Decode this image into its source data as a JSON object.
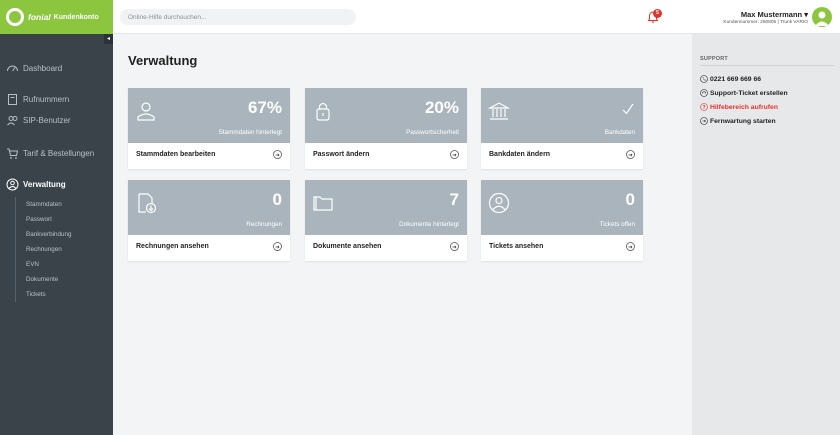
{
  "header": {
    "brand_name": "fonial",
    "brand_sub": "Kundenkonto",
    "search_placeholder": "Online-Hilfe durchsuchen...",
    "notification_count": "5",
    "user_name": "Max Mustermann ▾",
    "user_meta": "Kundennummer: 280805 | Trunk VARIO"
  },
  "sidebar": {
    "collapse_glyph": "◂",
    "items": [
      {
        "label": "Dashboard",
        "icon": "dashboard-icon"
      },
      {
        "label": "Rufnummern",
        "icon": "phonebook-icon"
      },
      {
        "label": "SIP-Benutzer",
        "icon": "users-icon"
      },
      {
        "label": "Tarif & Bestellungen",
        "icon": "cart-icon"
      },
      {
        "label": "Verwaltung",
        "icon": "user-circle-icon",
        "active": true
      }
    ],
    "subitems": [
      "Stammdaten",
      "Passwort",
      "Bankverbindung",
      "Rechnungen",
      "EVN",
      "Dokumente",
      "Tickets"
    ]
  },
  "main": {
    "title": "Verwaltung",
    "cards": [
      {
        "value": "67%",
        "label": "Stammdaten hinterlegt",
        "action": "Stammdaten bearbeiten",
        "icon": "person-icon"
      },
      {
        "value": "20%",
        "label": "Passwortsicherheit",
        "action": "Passwort ändern",
        "icon": "lock-icon"
      },
      {
        "value": "",
        "label": "Bankdaten",
        "action": "Bankdaten ändern",
        "icon": "bank-icon",
        "check": true
      },
      {
        "value": "0",
        "label": "Rechnungen",
        "action": "Rechnungen ansehen",
        "icon": "invoice-icon"
      },
      {
        "value": "7",
        "label": "Dokumente hinterlegt",
        "action": "Dokumente ansehen",
        "icon": "folder-icon"
      },
      {
        "value": "0",
        "label": "Tickets offen",
        "action": "Tickets ansehen",
        "icon": "ticket-user-icon"
      }
    ]
  },
  "support": {
    "title": "SUPPORT",
    "items": [
      {
        "label": "0221 669 669 66",
        "icon": "phone-icon",
        "color": "#222222"
      },
      {
        "label": "Support-Ticket erstellen",
        "icon": "headset-icon",
        "color": "#222222"
      },
      {
        "label": "Hilfebereich aufrufen",
        "icon": "help-icon",
        "color": "#e4312b"
      },
      {
        "label": "Fernwartung starten",
        "icon": "remote-icon",
        "color": "#222222"
      }
    ]
  },
  "colors": {
    "brand": "#8cc63f",
    "sidebar": "#394349",
    "card_top": "#a9b4bc",
    "alert": "#e4312b"
  }
}
